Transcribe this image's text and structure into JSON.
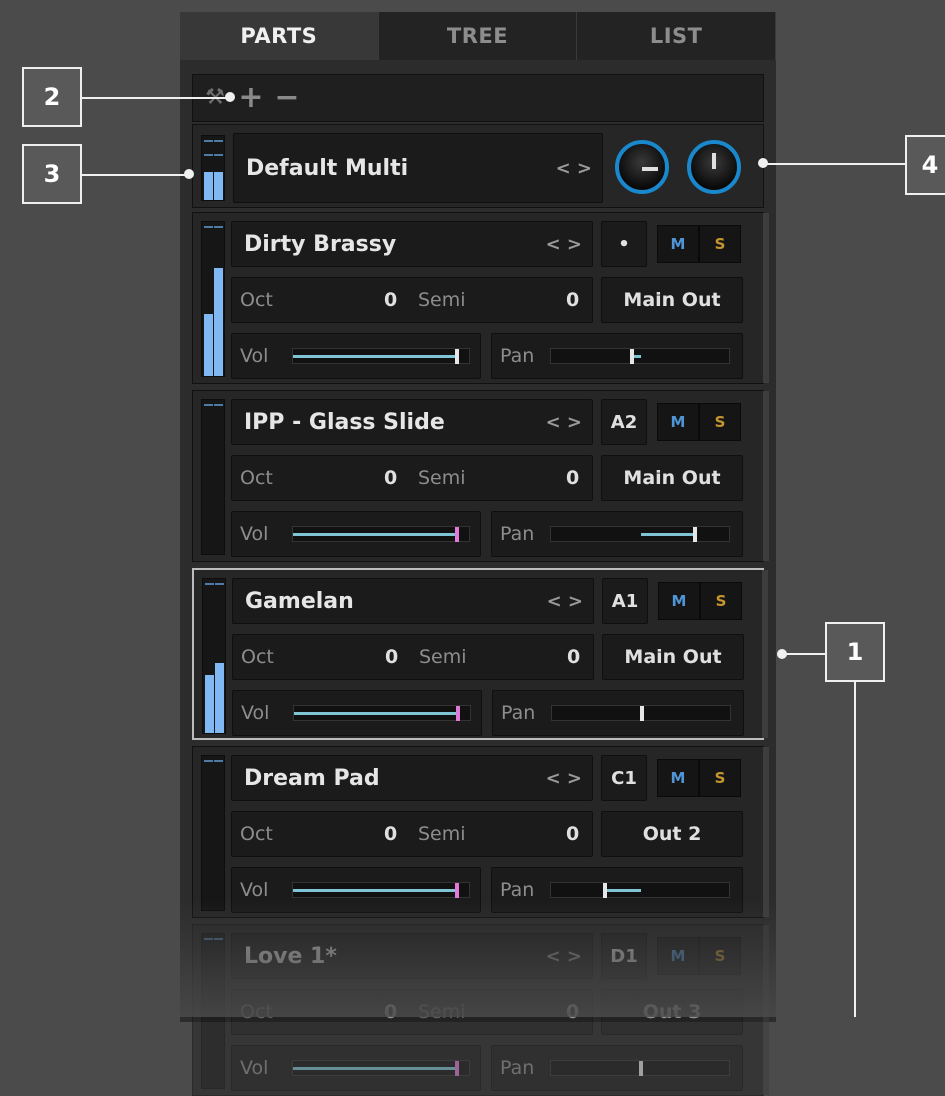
{
  "tabs": [
    "PARTS",
    "TREE",
    "LIST"
  ],
  "toolbar": {
    "icons": [
      "wrench-icon",
      "plus-icon",
      "minus-icon"
    ]
  },
  "multi": {
    "name": "Default Multi",
    "arrows": "< >"
  },
  "labels": {
    "oct": "Oct",
    "semi": "Semi",
    "vol": "Vol",
    "pan": "Pan",
    "mute": "M",
    "solo": "S",
    "arrows": "< >"
  },
  "parts": [
    {
      "name": "Dirty Brassy",
      "midi": "•",
      "oct": "0",
      "semi": "0",
      "output": "Main Out",
      "vol": 0.93,
      "pan": 0.45,
      "selected": false
    },
    {
      "name": "IPP - Glass Slide",
      "midi": "A2",
      "oct": "0",
      "semi": "0",
      "output": "Main Out",
      "vol": 0.93,
      "pan": 0.8,
      "selected": false
    },
    {
      "name": "Gamelan",
      "midi": "A1",
      "oct": "0",
      "semi": "0",
      "output": "Main Out",
      "vol": 0.93,
      "pan": 0.5,
      "selected": true
    },
    {
      "name": "Dream Pad",
      "midi": "C1",
      "oct": "0",
      "semi": "0",
      "output": "Out 2",
      "vol": 0.93,
      "pan": 0.3,
      "selected": false
    },
    {
      "name": "Love 1*",
      "midi": "D1",
      "oct": "0",
      "semi": "0",
      "output": "Out 3",
      "vol": 0.93,
      "pan": 0.5,
      "selected": false
    }
  ],
  "callouts": [
    "1",
    "2",
    "3",
    "4"
  ],
  "colors": {
    "accent": "#1a88cc",
    "meter": "#7fb8f2",
    "vol_thumb": "#e07ad8",
    "mute": "#4f95d6",
    "solo": "#c5962e"
  }
}
